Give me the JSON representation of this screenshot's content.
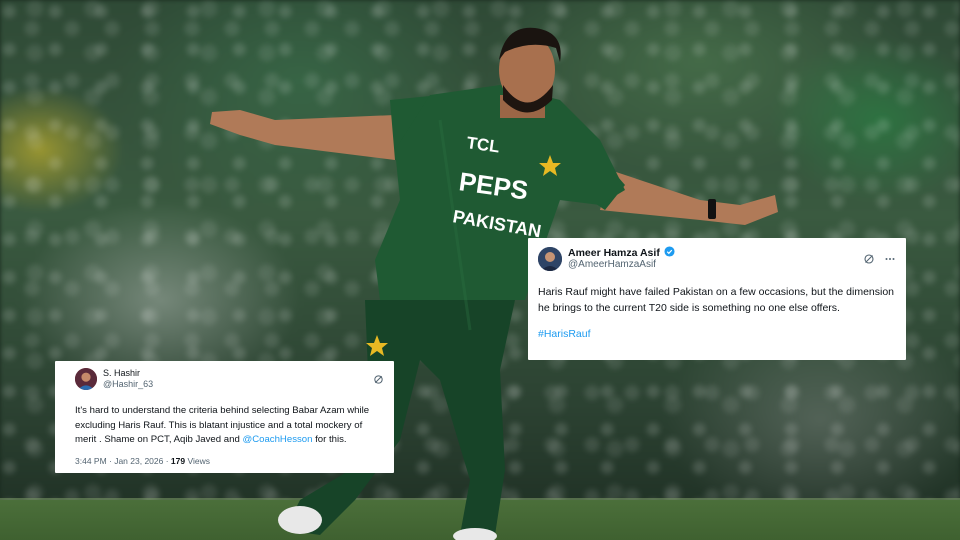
{
  "tweets": [
    {
      "name": "Ameer Hamza Asif",
      "handle": "@AmeerHamzaAsif",
      "verified_color": "#1d9bf0",
      "text": "Haris Rauf might have failed Pakistan on a few occasions, but the dimension he brings to the current T20 side is something no one else offers.",
      "hashtag": "#HarisRauf",
      "icons": [
        "grok-icon",
        "more-icon"
      ]
    },
    {
      "name": "S. Hashir",
      "handle": "@Hashir_63",
      "text_before": "It's hard to understand the criteria behind selecting Babar Azam while excluding Haris Rauf. This is blatant injustice and a total mockery of merit . Shame on PCT, Aqib Javed and ",
      "mention": "@CoachHesson",
      "text_after": " for this.",
      "time": "3:44 PM · Jan 23, 2026 · ",
      "views_count": "179",
      "views_label": " Views",
      "icons": [
        "grok-icon"
      ]
    }
  ],
  "jersey": {
    "sponsor_top": "TCL",
    "sponsor_main": "PEPS",
    "country": "PAKISTAN"
  },
  "colors": {
    "jersey_green": "#1f5a33",
    "link_blue": "#1d9bf0",
    "star_gold": "#e8b923"
  }
}
